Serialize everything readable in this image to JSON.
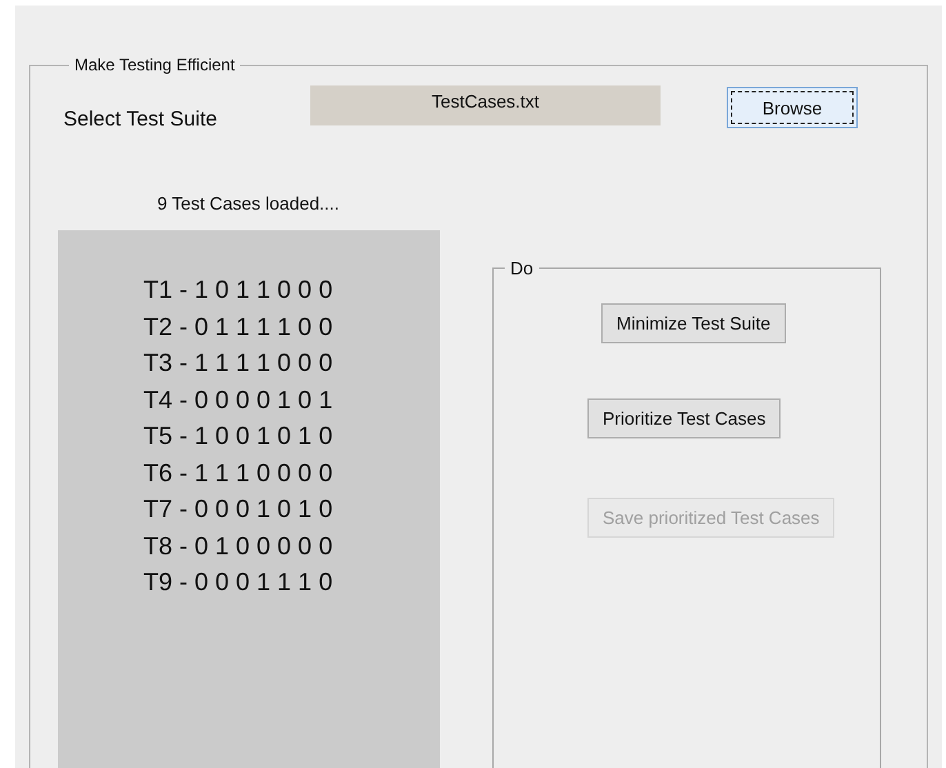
{
  "group": {
    "title": "Make Testing Efficient"
  },
  "select_label": "Select Test Suite",
  "file_field": {
    "value": "TestCases.txt"
  },
  "browse_button": {
    "label": "Browse",
    "focused": true
  },
  "status": "9 Test Cases loaded....",
  "test_cases": [
    "T1 - 1 0 1 1 0 0 0",
    "T2 - 0 1 1 1 1 0 0",
    "T3 - 1 1 1 1 0 0 0",
    "T4 - 0 0 0 0 1 0 1",
    "T5 - 1 0 0 1 0 1 0",
    "T6 - 1 1 1 0 0 0 0",
    "T7 - 0 0 0 1 0 1 0",
    "T8 - 0 1 0 0 0 0 0",
    "T9 - 0 0 0 1 1 1 0"
  ],
  "do_group": {
    "title": "Do",
    "buttons": [
      {
        "label": "Minimize Test Suite",
        "disabled": false
      },
      {
        "label": "Prioritize Test Cases",
        "disabled": false
      },
      {
        "label": "Save prioritized Test Cases",
        "disabled": true
      }
    ]
  }
}
